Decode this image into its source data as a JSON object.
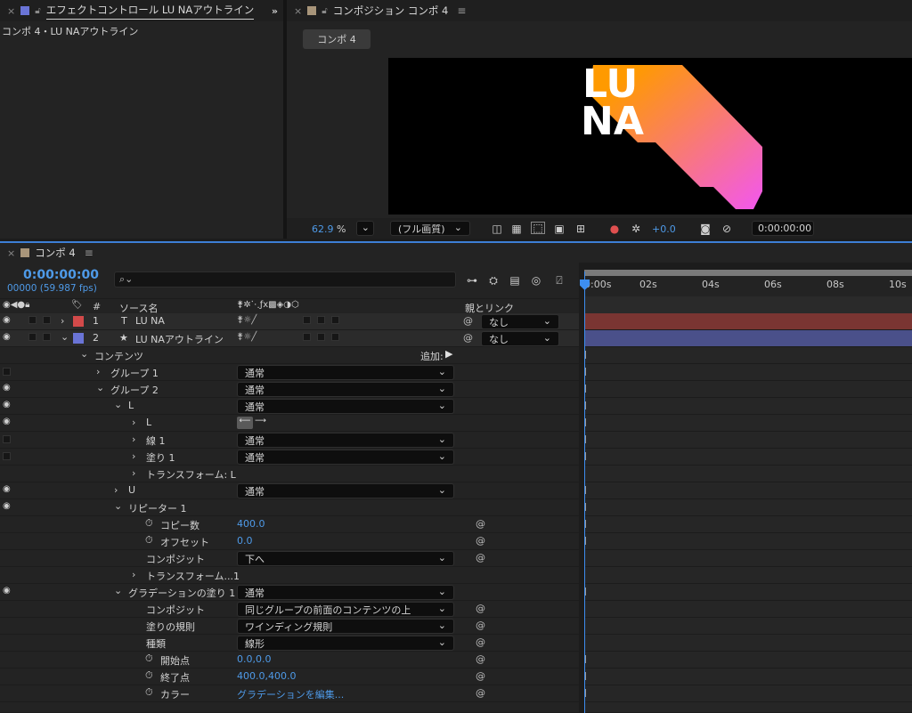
{
  "effect_panel": {
    "tab_title": "エフェクトコントロール LU NAアウトライン",
    "breadcrumb": "コンポ 4・LU NAアウトライン",
    "swatch_color": "#6a74d6"
  },
  "comp_panel": {
    "tab_title": "コンポジション コンポ 4",
    "comp_button": "コンポ 4",
    "swatch_color": "#a8957a",
    "zoom_value": "62.9",
    "zoom_unit": "%",
    "resolution": "(フル画質)",
    "exposure": "+0.0",
    "timecode": "0:00:00:00",
    "artwork": {
      "line1": "LU",
      "line2": "NA",
      "gradient_start": "#ff9a00",
      "gradient_end": "#f257f0"
    }
  },
  "timeline": {
    "tab_title": "コンポ 4",
    "swatch_color": "#a8957a",
    "timecode": "0:00:00:00",
    "frame_info": "00000 (59.987 fps)",
    "search_placeholder": "",
    "col_hash": "#",
    "col_source": "ソース名",
    "col_parent": "親とリンク",
    "ruler": [
      "0:00s",
      "02s",
      "04s",
      "06s",
      "08s",
      "10s"
    ],
    "layers": [
      {
        "num": "1",
        "type_icon": "T",
        "name": "LU NA",
        "color": "#d24a4a",
        "parent": "なし",
        "bar": "#7a3532"
      },
      {
        "num": "2",
        "type_icon": "★",
        "name": "LU NAアウトライン",
        "color": "#6a74d6",
        "parent": "なし",
        "bar": "#4a508a"
      }
    ],
    "contents_label": "コンテンツ",
    "add_label": "追加:",
    "props": {
      "group1": "グループ 1",
      "group2": "グループ 2",
      "L": "L",
      "L_sub": "L",
      "stroke1": "線 1",
      "fill1": "塗り 1",
      "transform_L": "トランスフォーム: L",
      "U": "U",
      "repeater": "リピーター 1",
      "copies_label": "コピー数",
      "copies_value": "400.0",
      "offset_label": "オフセット",
      "offset_value": "0.0",
      "composite_label": "コンポジット",
      "composite_value": "下へ",
      "transform_rep": "トランスフォーム...1",
      "gradfill": "グラデーションの塗り 1",
      "gf_composite_label": "コンポジット",
      "gf_composite_value": "同じグループの前面のコンテンツの上",
      "fill_rule_label": "塗りの規則",
      "fill_rule_value": "ワインディング規則",
      "kind_label": "種類",
      "kind_value": "線形",
      "start_label": "開始点",
      "start_value": "0.0,0.0",
      "end_label": "終了点",
      "end_value": "400.0,400.0",
      "color_label": "カラー",
      "color_value": "グラデーションを編集..."
    },
    "blend_normal": "通常"
  }
}
